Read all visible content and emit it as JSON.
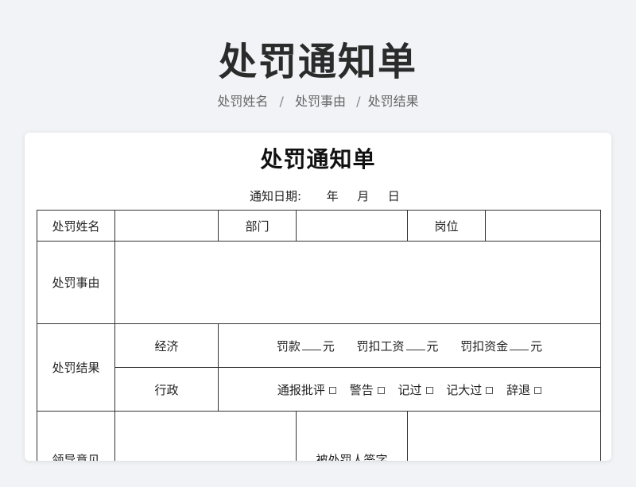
{
  "header": {
    "title": "处罚通知单",
    "breadcrumb": [
      "处罚姓名",
      "处罚事由",
      "处罚结果"
    ],
    "separator": "/"
  },
  "document": {
    "title": "处罚通知单",
    "date_label": "通知日期:",
    "date_year": "年",
    "date_month": "月",
    "date_day": "日"
  },
  "table": {
    "name_label": "处罚姓名",
    "dept_label": "部门",
    "post_label": "岗位",
    "reason_label": "处罚事由",
    "result_label": "处罚结果",
    "economic_label": "经济",
    "fine_label": "罚款",
    "wage_label": "罚扣工资",
    "fund_label": "罚扣资金",
    "yuan": "元",
    "admin_label": "行政",
    "admin_options": [
      "通报批评",
      "警告",
      "记过",
      "记大过",
      "辞退"
    ],
    "leader_label": "领导意见",
    "signee_label": "被处罚人签字"
  }
}
